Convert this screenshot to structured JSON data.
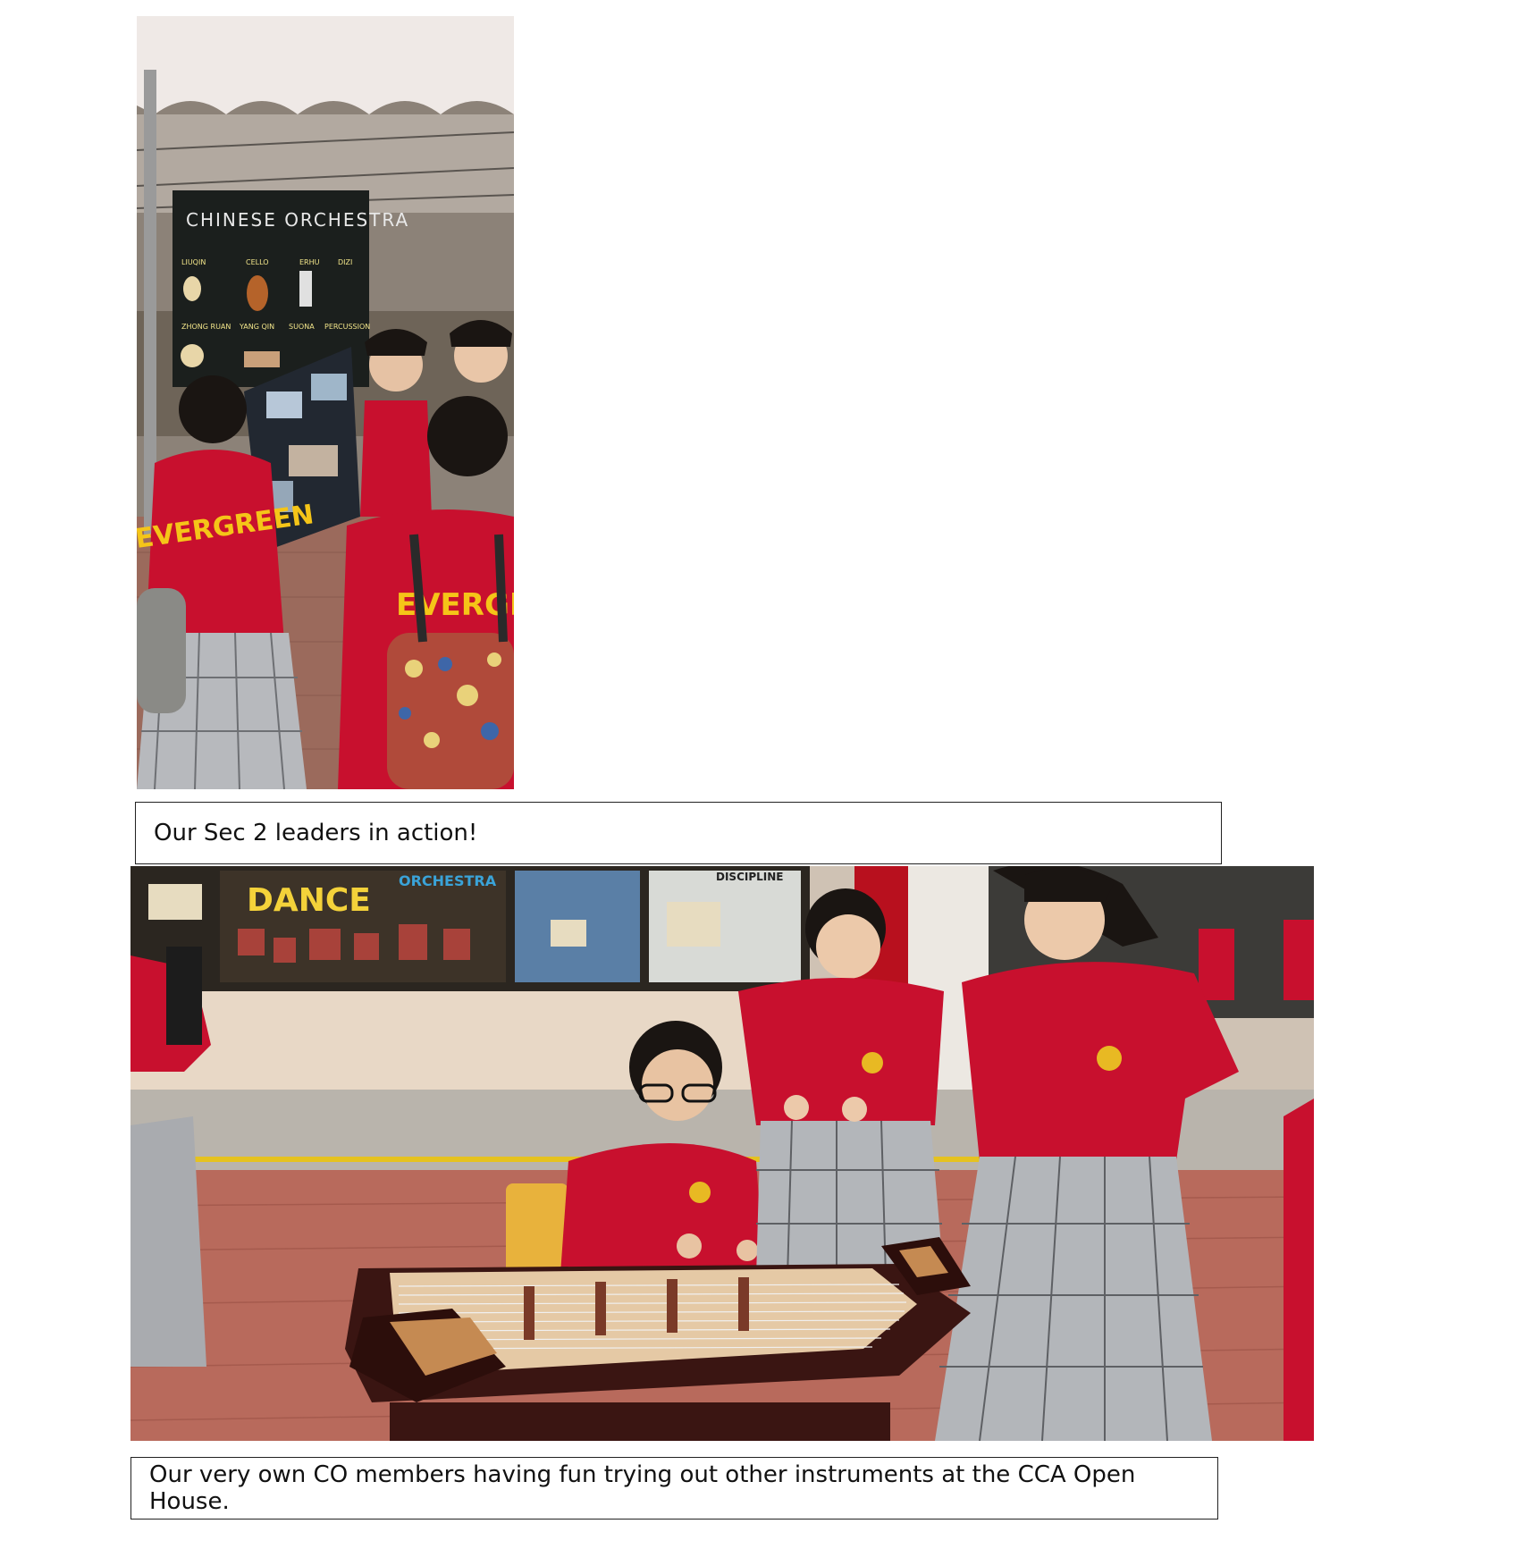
{
  "photos": {
    "photo1": {
      "board_title": "CHINESE ORCHESTRA",
      "board_instruments": [
        "LIUQIN",
        "CELLO",
        "ERHU",
        "DIZI",
        "ZHONG RUAN",
        "YANG QIN",
        "SUONA",
        "PERCUSSION"
      ],
      "shirt_text": "EVERGREEN"
    },
    "photo2": {
      "banner_dance": "DANCE",
      "banner_orchestra": "ORCHESTRA",
      "banner_discipline": "DISCIPLINE"
    }
  },
  "captions": {
    "caption1": "Our Sec 2 leaders in action!",
    "caption2": "Our very own CO members having fun trying out other instruments at the CCA Open House."
  },
  "colors": {
    "uniform_red": "#c8102e",
    "board_black": "#1b1f1d",
    "paving": "#b86a5c"
  }
}
